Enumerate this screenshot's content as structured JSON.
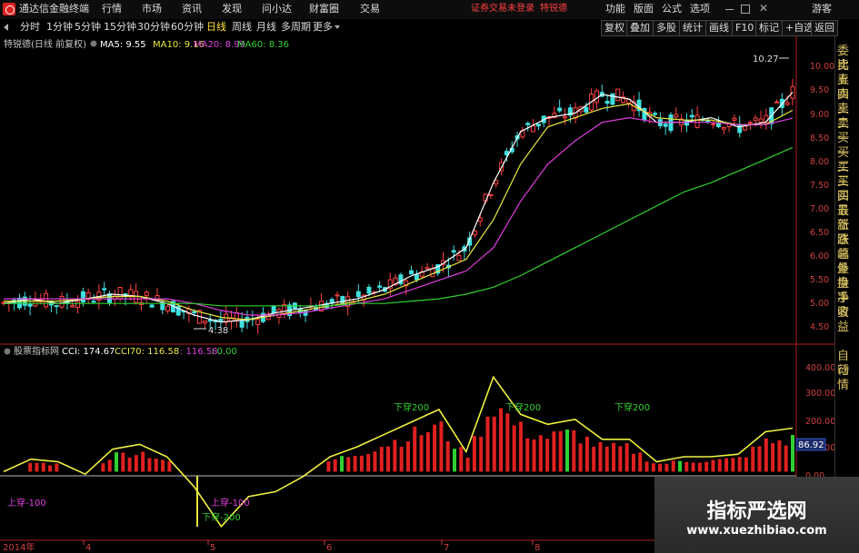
{
  "app": {
    "title": "通达信金融终端",
    "menu": [
      "行情",
      "市场",
      "资讯",
      "发现",
      "问小达",
      "财富圈",
      "交易"
    ],
    "notice": "证券交易未登录",
    "stock_name": "特锐德",
    "right_menu": [
      "功能",
      "版面",
      "公式",
      "选项"
    ],
    "guest": "游客"
  },
  "toolbar": {
    "periods": [
      "分时",
      "1分钟",
      "5分钟",
      "15分钟",
      "30分钟",
      "60分钟",
      "日线",
      "周线",
      "月线",
      "多周期",
      "更多"
    ],
    "active_period": "日线",
    "right_buttons": [
      "复权",
      "叠加",
      "多股",
      "统计",
      "画线",
      "F10",
      "标记",
      "+自选",
      "返回"
    ]
  },
  "main_chart": {
    "header": "特锐德(日线 前复权)",
    "ma": [
      {
        "label": "MA5: 9.55",
        "color": "#ffffff"
      },
      {
        "label": "MA10: 9.16",
        "color": "#e8e840"
      },
      {
        "label": "MA20: 8.99",
        "color": "#e040e0"
      },
      {
        "label": "MA60: 8.36",
        "color": "#30d030"
      }
    ],
    "price_axis": [
      "10.00",
      "9.50",
      "9.00",
      "8.50",
      "8.00",
      "7.50",
      "7.00",
      "6.50",
      "6.00",
      "5.50",
      "5.00",
      "4.50"
    ],
    "high_label": "10.27",
    "low_label": "4.38"
  },
  "indicator": {
    "header": "股票指标网",
    "values": [
      {
        "label": "CCI: 174.67",
        "color": "#ffffff"
      },
      {
        "label": "CCI70: 116.58",
        "color": "#e8e840"
      },
      {
        "label": ": 116.58",
        "color": "#e040e0"
      },
      {
        "label": ": 0.00",
        "color": "#30d030"
      }
    ],
    "axis": [
      "400.00",
      "300.00",
      "200.00",
      "100.00",
      "0.00"
    ],
    "current_value": "86.92",
    "annotations": [
      {
        "text": "下穿200",
        "color": "#30d030"
      },
      {
        "text": "下穿200",
        "color": "#30d030"
      },
      {
        "text": "下穿200",
        "color": "#30d030"
      },
      {
        "text": "上穿-100",
        "color": "#e040e0"
      },
      {
        "text": "上穿-100",
        "color": "#e040e0"
      },
      {
        "text": "下穿-200",
        "color": "#30d030"
      }
    ]
  },
  "dates": [
    "2014年",
    "4",
    "5",
    "6",
    "7",
    "8"
  ],
  "side_panel": [
    "委比",
    "卖五",
    "卖四",
    "卖三",
    "卖二",
    "卖一",
    "买一",
    "买二",
    "买三",
    "买四",
    "买五",
    "最新",
    "涨跌",
    "涨幅",
    "总量",
    "外盘",
    "换手",
    "净资",
    "收益"
  ],
  "side_panel_bottom": [
    "自动",
    "行情"
  ],
  "watermark": {
    "title": "指标严选网",
    "url": "www.xuezhibiao.com"
  },
  "chart_data": {
    "type": "line",
    "title": "特锐德(日线 前复权)",
    "y_unit": "price",
    "ylim": [
      4.3,
      10.4
    ],
    "series": [
      {
        "name": "MA5",
        "values": [
          5.0,
          5.1,
          5.0,
          5.1,
          5.2,
          5.15,
          5.0,
          4.75,
          4.6,
          4.65,
          4.8,
          4.9,
          5.0,
          5.1,
          5.3,
          5.6,
          5.8,
          6.2,
          7.6,
          8.7,
          9.0,
          9.1,
          9.5,
          9.4,
          8.9,
          8.9,
          9.0,
          8.8,
          8.9,
          9.55
        ]
      },
      {
        "name": "MA10",
        "values": [
          5.05,
          5.05,
          5.05,
          5.1,
          5.15,
          5.15,
          5.05,
          4.85,
          4.7,
          4.65,
          4.75,
          4.85,
          4.95,
          5.05,
          5.2,
          5.45,
          5.7,
          5.95,
          6.8,
          8.0,
          8.8,
          9.0,
          9.2,
          9.3,
          9.0,
          8.95,
          8.95,
          8.85,
          8.85,
          9.16
        ]
      },
      {
        "name": "MA20",
        "values": [
          5.1,
          5.1,
          5.1,
          5.1,
          5.1,
          5.1,
          5.1,
          5.0,
          4.85,
          4.75,
          4.75,
          4.8,
          4.9,
          5.0,
          5.1,
          5.3,
          5.5,
          5.7,
          6.2,
          7.2,
          8.0,
          8.5,
          8.9,
          9.0,
          8.9,
          8.9,
          8.9,
          8.85,
          8.85,
          8.99
        ]
      },
      {
        "name": "MA60",
        "values": [
          5.0,
          5.0,
          5.0,
          5.0,
          5.0,
          5.0,
          5.0,
          5.0,
          4.95,
          4.95,
          4.95,
          4.95,
          4.95,
          5.0,
          5.0,
          5.05,
          5.1,
          5.2,
          5.35,
          5.6,
          5.9,
          6.2,
          6.5,
          6.8,
          7.1,
          7.4,
          7.6,
          7.85,
          8.1,
          8.36
        ]
      }
    ],
    "cci": {
      "xlim": [
        0,
        100
      ],
      "ylim": [
        -250,
        450
      ],
      "values": [
        0,
        50,
        40,
        -10,
        90,
        110,
        60,
        -60,
        -220,
        -100,
        -80,
        -20,
        60,
        100,
        150,
        200,
        250,
        80,
        380,
        230,
        190,
        210,
        130,
        130,
        40,
        60,
        60,
        70,
        160,
        174.67
      ]
    }
  }
}
